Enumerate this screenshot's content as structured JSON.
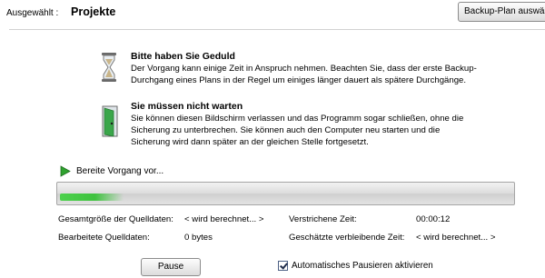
{
  "header": {
    "label": "Ausgewählt :",
    "value": "Projekte",
    "select_plan_button": "Backup-Plan auswä"
  },
  "info": {
    "wait": {
      "icon": "hourglass-icon",
      "title": "Bitte haben Sie Geduld",
      "lines": [
        "Der Vorgang kann einige Zeit in Anspruch nehmen. Beachten Sie, dass der erste Backup-",
        "Durchgang eines Plans in der Regel um einiges länger dauert als spätere Durchgänge."
      ]
    },
    "no_wait": {
      "icon": "door-exit-icon",
      "title": "Sie müssen nicht warten",
      "lines": [
        "Sie können diesen Bildschirm verlassen und das Programm sogar schließen, ohne die",
        "Sicherung zu unterbrechen. Sie können auch den Computer neu starten und die",
        "Sicherung wird dann später an der gleichen Stelle fortgesetzt."
      ]
    }
  },
  "status": {
    "icon": "play-icon",
    "text": "Bereite Vorgang vor...",
    "progress_fraction": 0.14,
    "accent_color": "#3fc23f"
  },
  "stats": {
    "total_size_label": "Gesamtgröße der Quelldaten:",
    "total_size_value": "< wird berechnet... >",
    "elapsed_label": "Verstrichene Zeit:",
    "elapsed_value": "00:00:12",
    "processed_label": "Bearbeitete Quelldaten:",
    "processed_value": "0 bytes",
    "remaining_label": "Geschätzte verbleibende Zeit:",
    "remaining_value": "< wird berechnet... >"
  },
  "footer": {
    "pause_button": "Pause",
    "auto_pause_label": "Automatisches Pausieren aktivieren",
    "auto_pause_checked": true
  }
}
